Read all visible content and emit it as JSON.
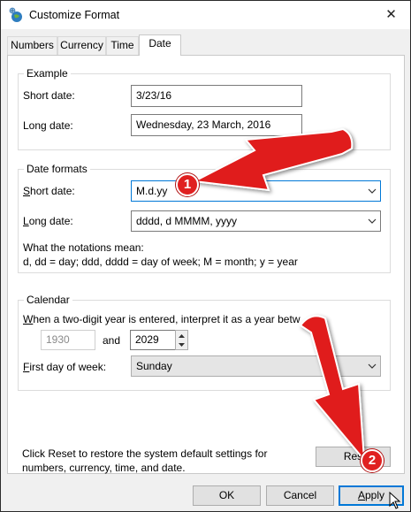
{
  "window": {
    "title": "Customize Format",
    "close_glyph": "✕"
  },
  "tabs": [
    {
      "label": "Numbers",
      "active": false
    },
    {
      "label": "Currency",
      "active": false
    },
    {
      "label": "Time",
      "active": false
    },
    {
      "label": "Date",
      "active": true
    }
  ],
  "example": {
    "group_label": "Example",
    "short_label": "Short date:",
    "short_value": "3/23/16",
    "long_label": "Long date:",
    "long_value": "Wednesday, 23 March, 2016"
  },
  "date_formats": {
    "group_label": "Date formats",
    "short_label_u": "S",
    "short_label_rest": "hort date:",
    "short_value": "M.d.yy",
    "long_label_u": "L",
    "long_label_rest": "ong date:",
    "long_value": "dddd, d MMMM, yyyy",
    "notation_title": "What the notations mean:",
    "notation_text": "d, dd = day;  ddd, dddd = day of week;  M = month;  y = year"
  },
  "calendar": {
    "group_label": "Calendar",
    "two_digit_u": "W",
    "two_digit_rest": "hen a two-digit year is entered, interpret it as a year betw",
    "year_from": "1930",
    "and_label": "and",
    "year_to": "2029",
    "first_day_u": "F",
    "first_day_rest": "irst day of week:",
    "first_day_value": "Sunday"
  },
  "reset": {
    "description_line1": "Click Reset to restore the system default settings for",
    "description_line2": "numbers, currency, time, and date.",
    "button_label": "Res"
  },
  "footer": {
    "ok_label": "OK",
    "cancel_label": "Cancel",
    "apply_label_u": "A",
    "apply_label_rest": "pply"
  },
  "annotations": {
    "badge1": "1",
    "badge2": "2"
  },
  "colors": {
    "arrow_red": "#e01b1b",
    "focus_blue": "#0078d7",
    "panel_bg": "#ffffff",
    "dialog_bg": "#f0f0f0"
  }
}
